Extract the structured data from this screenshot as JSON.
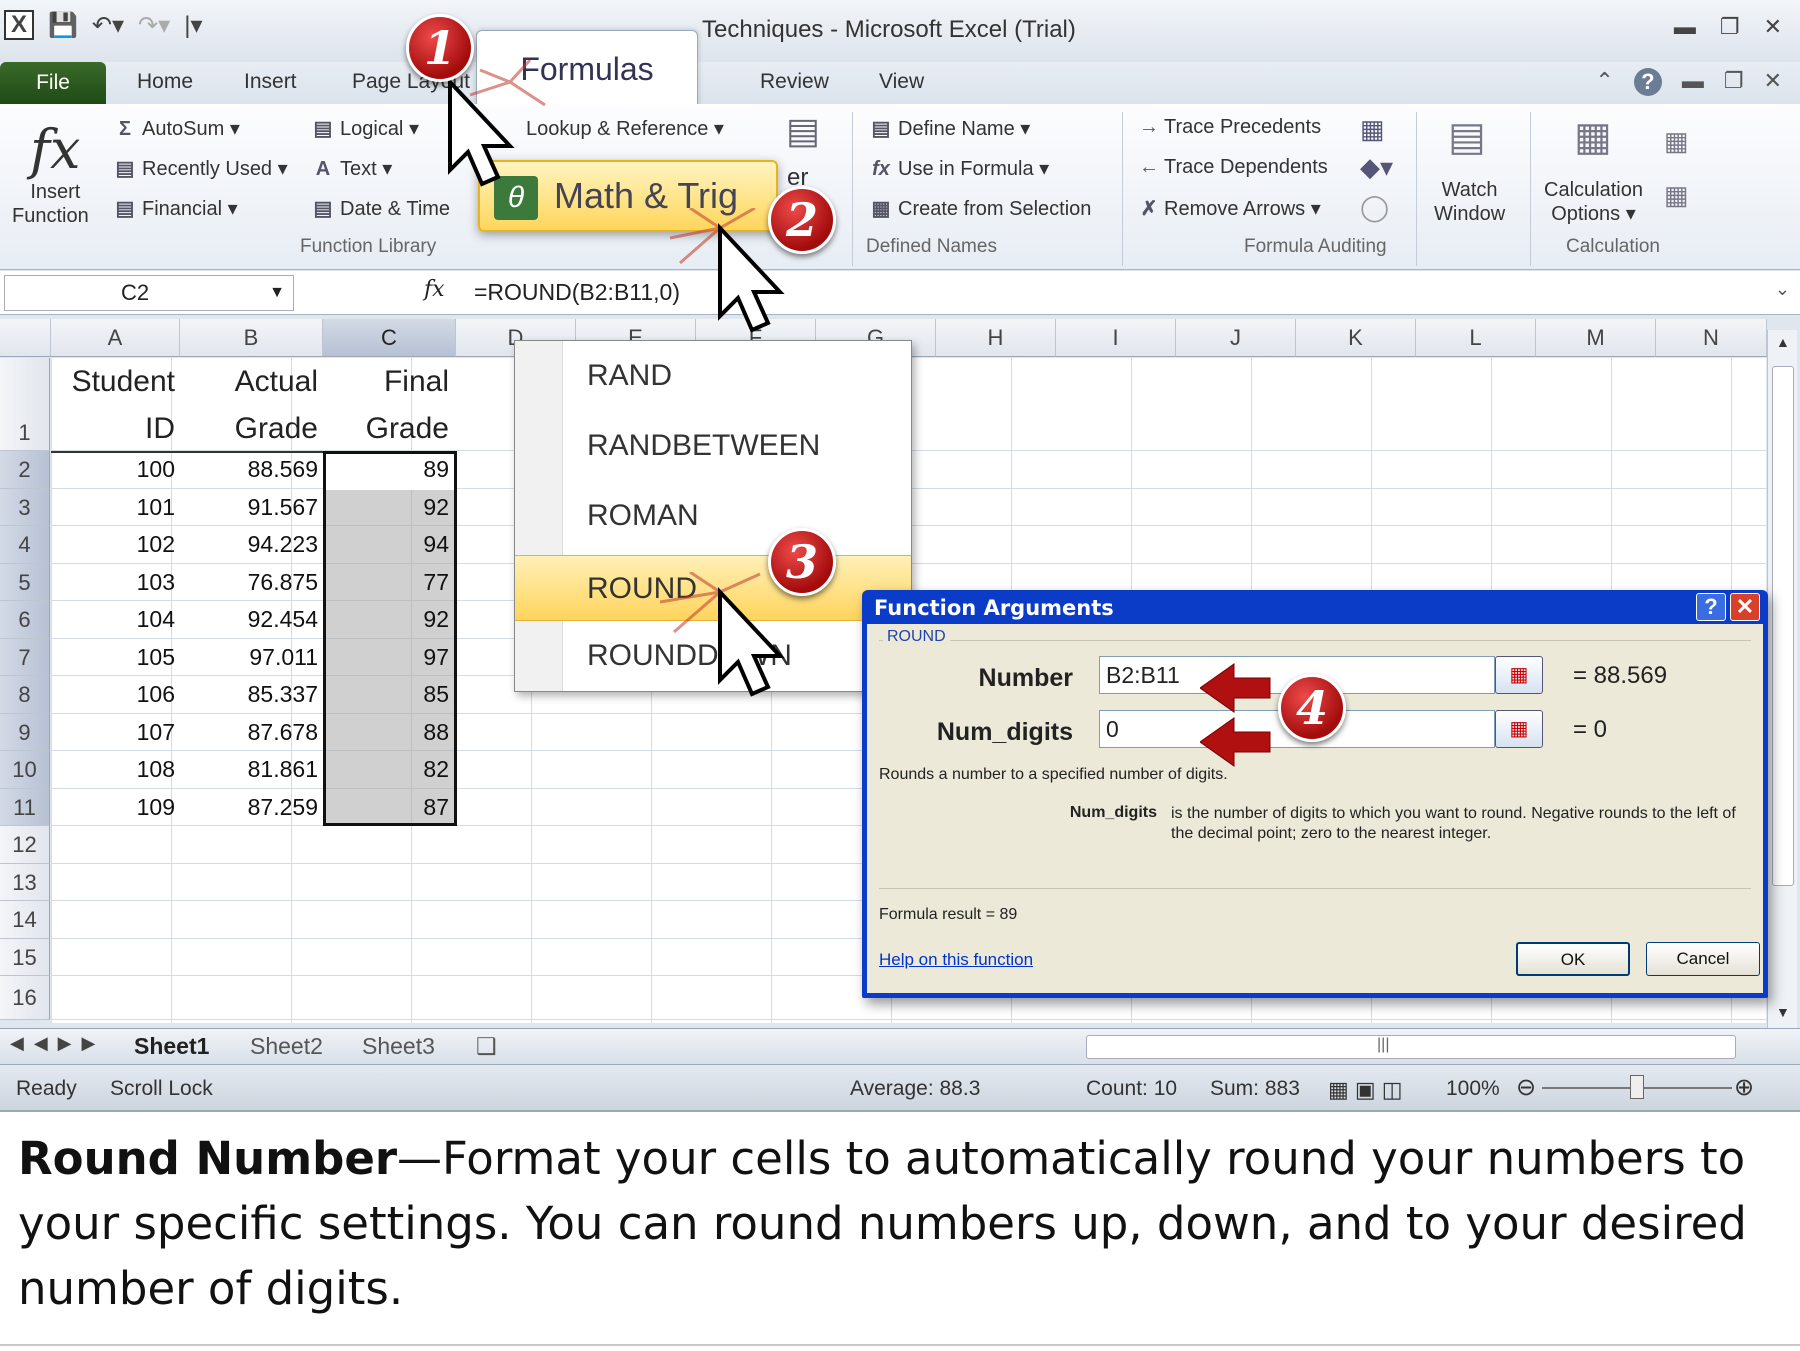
{
  "window": {
    "title": "Techniques  -  Microsoft Excel (Trial)"
  },
  "tabs": [
    "File",
    "Home",
    "Insert",
    "Page Layout",
    "Formulas",
    "Review",
    "View"
  ],
  "ribbon": {
    "insert_function": [
      "Insert",
      "Function"
    ],
    "library_col1": [
      "AutoSum",
      "Recently Used",
      "Financial"
    ],
    "library_col2": [
      "Logical",
      "Text",
      "Date & Time"
    ],
    "lookup": "Lookup & Reference",
    "math_trig": "Math & Trig",
    "more_fragment": "er",
    "defined_names": [
      "Define Name",
      "Use in Formula",
      "Create from Selection"
    ],
    "auditing": [
      "Trace Precedents",
      "Trace Dependents",
      "Remove Arrows"
    ],
    "watch": [
      "Watch",
      "Window"
    ],
    "calc": [
      "Calculation",
      "Options"
    ],
    "groups": {
      "library": "Function Library",
      "names": "Defined Names",
      "auditing": "Formula Auditing",
      "calculation": "Calculation"
    }
  },
  "formula_bar": {
    "name_box": "C2",
    "formula": "=ROUND(B2:B11,0)"
  },
  "columns": [
    "A",
    "B",
    "C",
    "D",
    "E",
    "F",
    "G",
    "H",
    "I",
    "J",
    "K",
    "L",
    "M",
    "N"
  ],
  "rows": [
    "1",
    "2",
    "3",
    "4",
    "5",
    "6",
    "7",
    "8",
    "9",
    "10",
    "11",
    "12",
    "13",
    "14",
    "15",
    "16"
  ],
  "headers": {
    "a": [
      "Student",
      "ID"
    ],
    "b": [
      "Actual",
      "Grade"
    ],
    "c": [
      "Final",
      "Grade"
    ]
  },
  "data": [
    {
      "id": "100",
      "actual": "88.569",
      "final": "89"
    },
    {
      "id": "101",
      "actual": "91.567",
      "final": "92"
    },
    {
      "id": "102",
      "actual": "94.223",
      "final": "94"
    },
    {
      "id": "103",
      "actual": "76.875",
      "final": "77"
    },
    {
      "id": "104",
      "actual": "92.454",
      "final": "92"
    },
    {
      "id": "105",
      "actual": "97.011",
      "final": "97"
    },
    {
      "id": "106",
      "actual": "85.337",
      "final": "85"
    },
    {
      "id": "107",
      "actual": "87.678",
      "final": "88"
    },
    {
      "id": "108",
      "actual": "81.861",
      "final": "82"
    },
    {
      "id": "109",
      "actual": "87.259",
      "final": "87"
    }
  ],
  "menu": [
    "RAND",
    "RANDBETWEEN",
    "ROMAN",
    "ROUND",
    "ROUNDDOWN"
  ],
  "sheets": [
    "Sheet1",
    "Sheet2",
    "Sheet3"
  ],
  "status": {
    "ready": "Ready",
    "scroll_lock": "Scroll Lock",
    "average": "Average: 88.3",
    "count": "Count: 10",
    "sum": "Sum: 883",
    "zoom": "100%"
  },
  "dialog": {
    "title": "Function Arguments",
    "function": "ROUND",
    "arg1_label": "Number",
    "arg1_value": "B2:B11",
    "arg1_result": "=  88.569",
    "arg2_label": "Num_digits",
    "arg2_value": "0",
    "arg2_result": "=  0",
    "description": "Rounds a number to a specified number of digits.",
    "arg_help_name": "Num_digits",
    "arg_help_text": "is the number of digits to which you want to round. Negative rounds to the left of the decimal point; zero to the nearest integer.",
    "formula_result": "Formula result =   89",
    "help_link": "Help on this function",
    "ok": "OK",
    "cancel": "Cancel"
  },
  "badges": [
    "1",
    "2",
    "3",
    "4"
  ],
  "caption": {
    "bold": "Round Number",
    "rest": "—Format your cells to automatically round your numbers to your specific settings.  You can round numbers up, down, and to your desired number of digits."
  },
  "colors": {
    "file_tab": "#2e5e22",
    "dialog_title": "#0a3cc8",
    "highlight": "#ffd45c",
    "badge": "#c01a1a",
    "arrow": "#b01010"
  }
}
